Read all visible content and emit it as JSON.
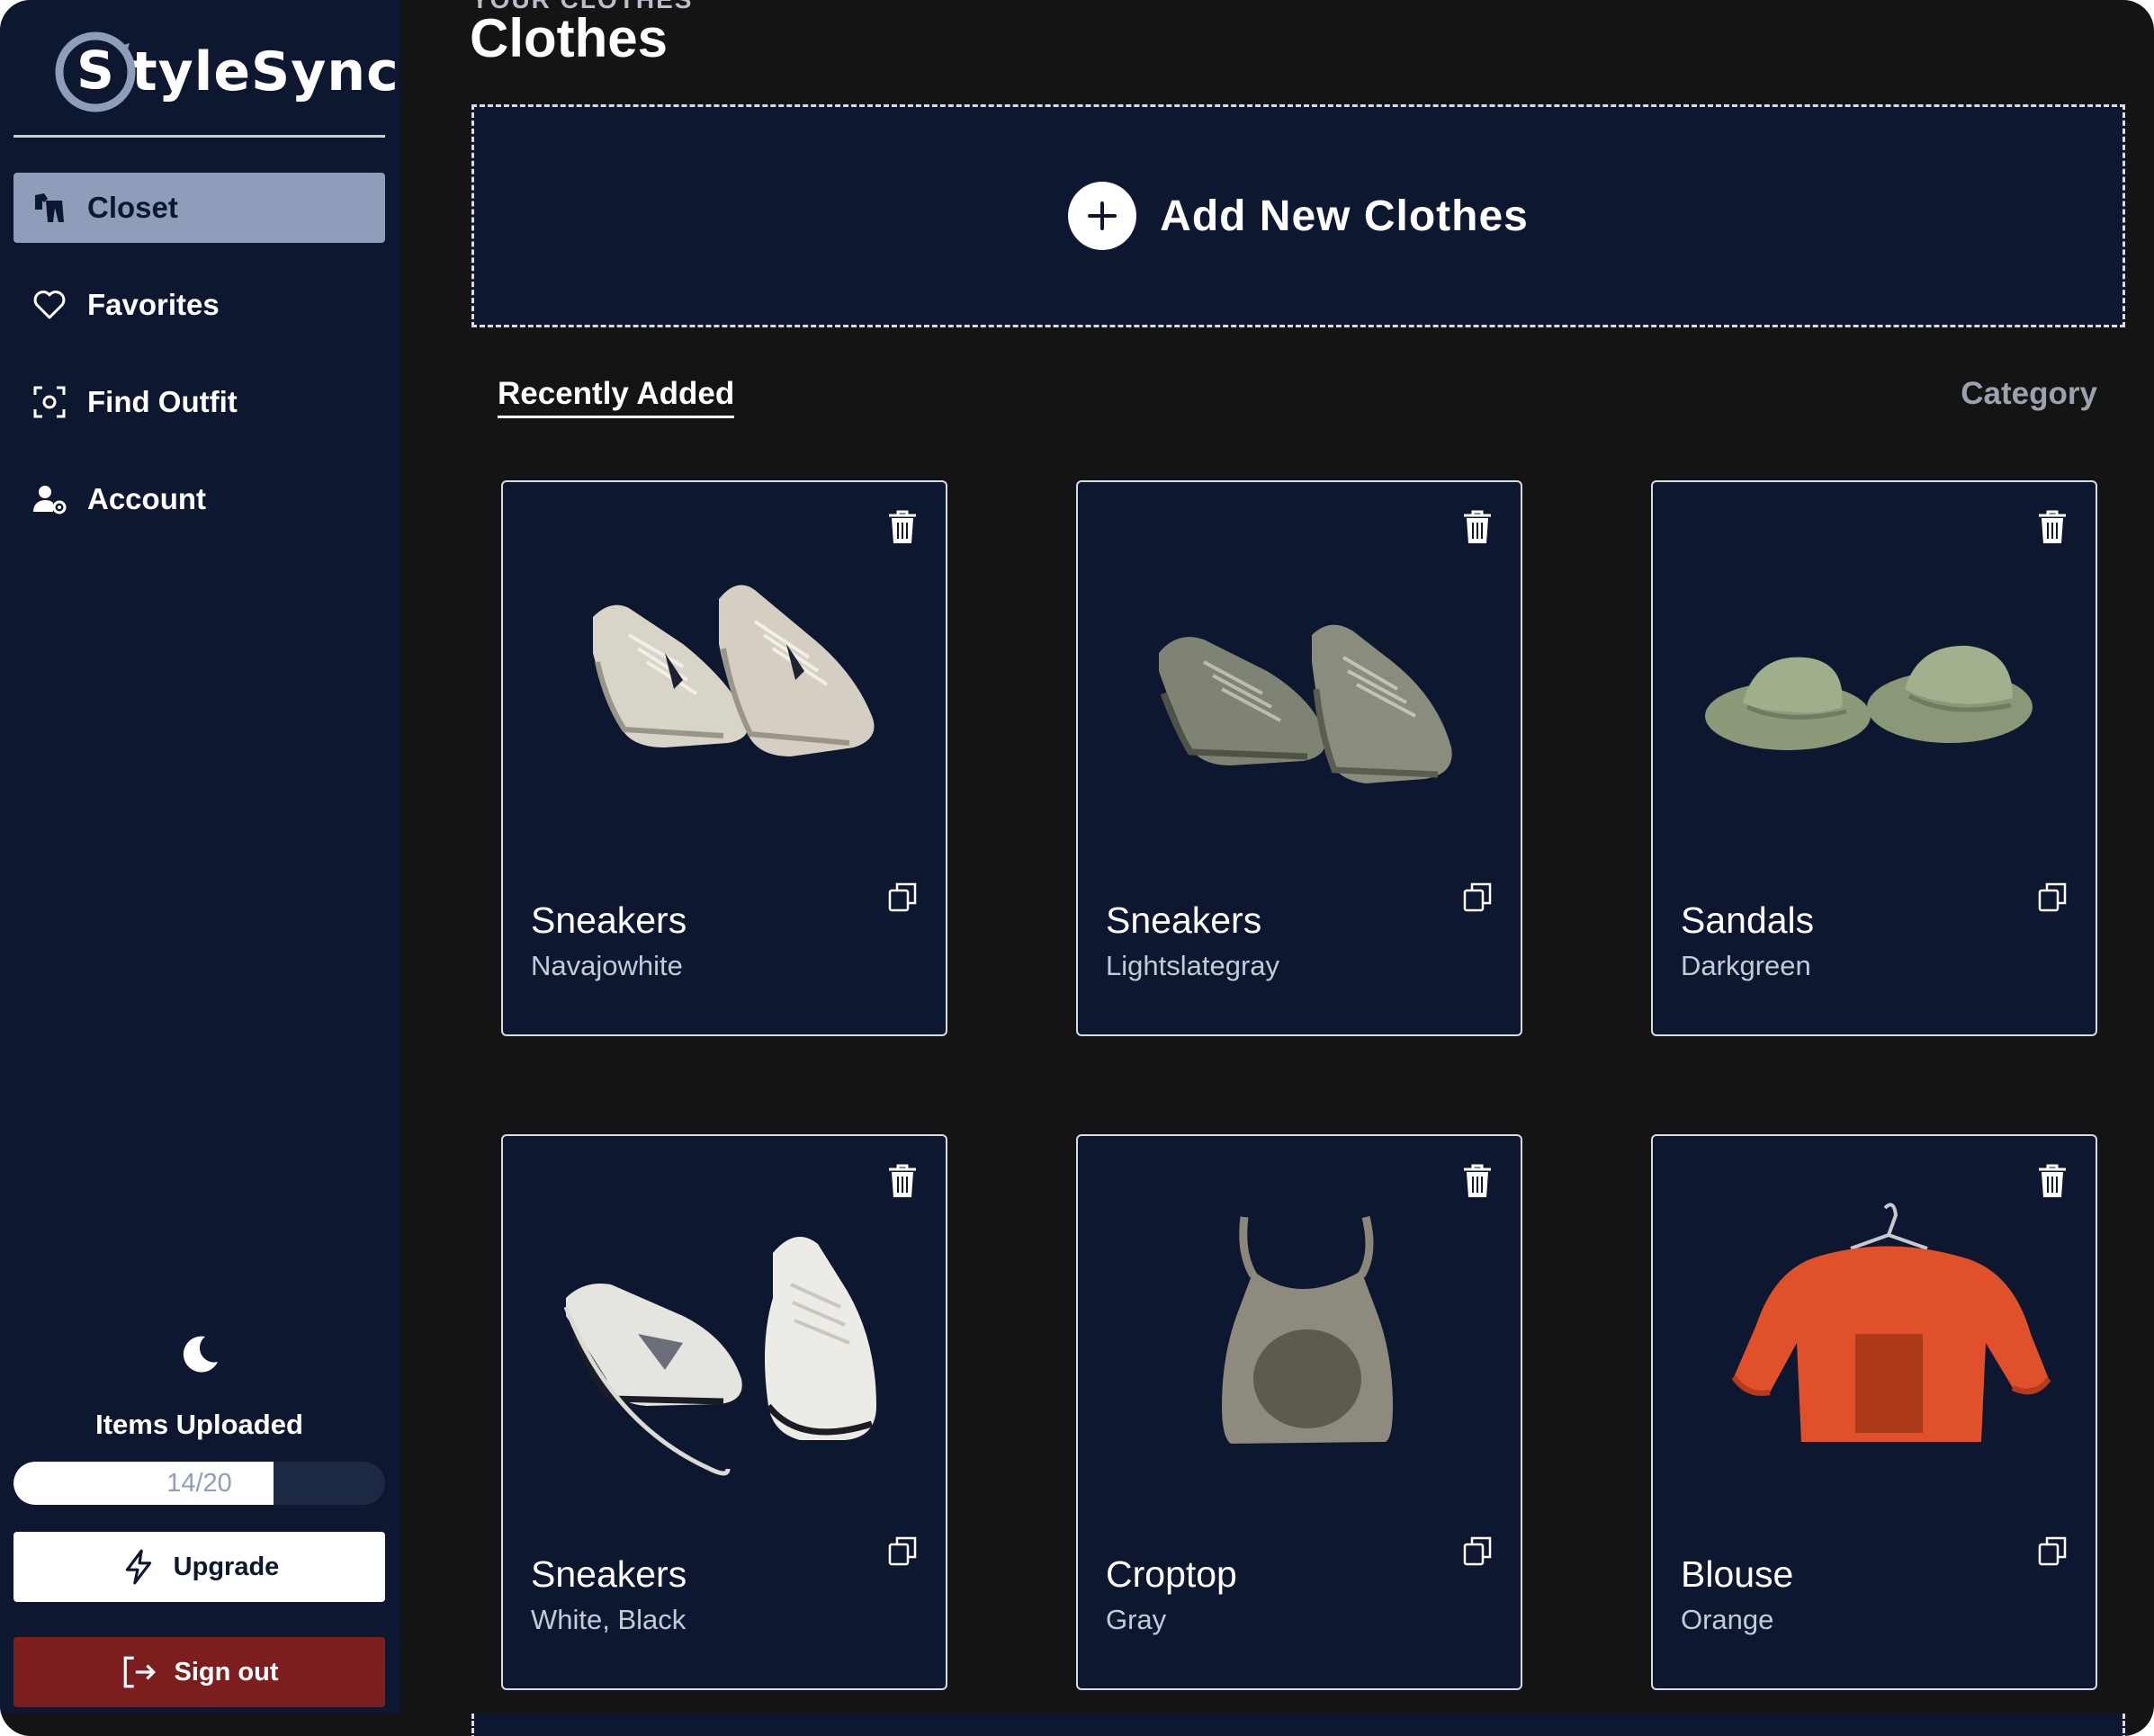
{
  "app": {
    "name_initial": "S",
    "name_rest": "tyleSync"
  },
  "sidebar": {
    "items": [
      {
        "label": "Closet",
        "icon": "closet-icon",
        "active": true
      },
      {
        "label": "Favorites",
        "icon": "heart-icon",
        "active": false
      },
      {
        "label": "Find Outfit",
        "icon": "scan-icon",
        "active": false
      },
      {
        "label": "Account",
        "icon": "user-gear-icon",
        "active": false
      }
    ],
    "theme_toggle_icon": "moon-icon",
    "items_uploaded_label": "Items Uploaded",
    "progress": {
      "text": "14/20",
      "fraction": 0.7
    },
    "upgrade_label": "Upgrade",
    "signout_label": "Sign out"
  },
  "main": {
    "eyebrow": "YOUR CLOTHES",
    "title": "Clothes",
    "add_label": "Add New Clothes",
    "tabs": {
      "recent": "Recently Added",
      "category": "Category"
    },
    "cards": [
      {
        "name": "Sneakers",
        "color": "Navajowhite",
        "art": "sneakers-white-icon"
      },
      {
        "name": "Sneakers",
        "color": "Lightslategray",
        "art": "sneakers-gray-icon"
      },
      {
        "name": "Sandals",
        "color": "Darkgreen",
        "art": "sandals-icon"
      },
      {
        "name": "Sneakers",
        "color": "White, Black",
        "art": "sneakers-laces-icon"
      },
      {
        "name": "Croptop",
        "color": "Gray",
        "art": "croptop-icon"
      },
      {
        "name": "Blouse",
        "color": "Orange",
        "art": "blouse-icon"
      }
    ]
  },
  "colors": {
    "sidebar_bg": "#0e1730",
    "page_bg": "#141414",
    "active_nav": "#8f9dba",
    "signout": "#7d1e1e"
  }
}
